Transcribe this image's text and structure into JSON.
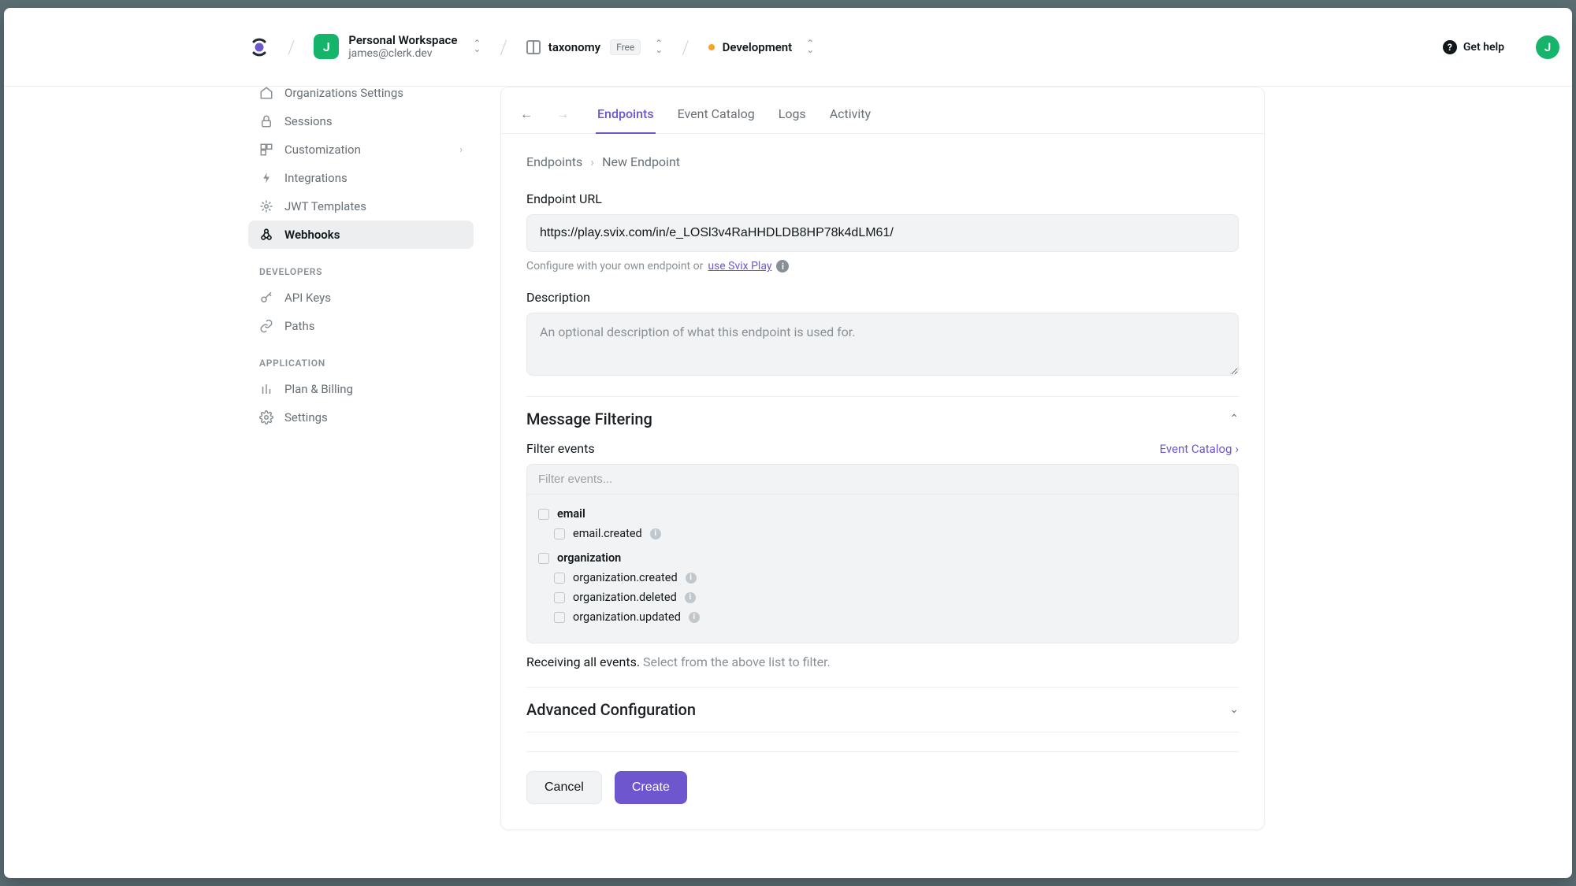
{
  "header": {
    "workspace": {
      "initial": "J",
      "name": "Personal Workspace",
      "email": "james@clerk.dev"
    },
    "app": {
      "name": "taxonomy",
      "plan": "Free"
    },
    "env": {
      "name": "Development"
    },
    "help_label": "Get help",
    "avatar_initial": "J"
  },
  "sidebar": {
    "main": [
      {
        "icon": "org",
        "label": "Organizations Settings"
      },
      {
        "icon": "lock",
        "label": "Sessions"
      },
      {
        "icon": "cust",
        "label": "Customization",
        "expandable": true
      },
      {
        "icon": "plug",
        "label": "Integrations"
      },
      {
        "icon": "jwt",
        "label": "JWT Templates"
      },
      {
        "icon": "hook",
        "label": "Webhooks",
        "active": true
      }
    ],
    "dev_head": "DEVELOPERS",
    "developers": [
      {
        "icon": "key",
        "label": "API Keys"
      },
      {
        "icon": "path",
        "label": "Paths"
      }
    ],
    "app_head": "APPLICATION",
    "application": [
      {
        "icon": "bill",
        "label": "Plan & Billing"
      },
      {
        "icon": "gear",
        "label": "Settings"
      }
    ]
  },
  "tabs": [
    "Endpoints",
    "Event Catalog",
    "Logs",
    "Activity"
  ],
  "active_tab": "Endpoints",
  "breadcrumb": {
    "root": "Endpoints",
    "leaf": "New Endpoint"
  },
  "form": {
    "url_label": "Endpoint URL",
    "url_value": "https://play.svix.com/in/e_LOSl3v4RaHHDLDB8HP78k4dLM61/",
    "url_hint_pre": "Configure with your own endpoint or ",
    "url_hint_link": "use Svix Play",
    "desc_label": "Description",
    "desc_placeholder": "An optional description of what this endpoint is used for.",
    "msg_filter_title": "Message Filtering",
    "filter_events_label": "Filter events",
    "event_catalog_link": "Event Catalog",
    "filter_placeholder": "Filter events...",
    "event_groups": [
      {
        "name": "email",
        "events": [
          "email.created"
        ]
      },
      {
        "name": "organization",
        "events": [
          "organization.created",
          "organization.deleted",
          "organization.updated"
        ]
      }
    ],
    "receiving_bold": "Receiving all events.",
    "receiving_rest": " Select from the above list to filter.",
    "adv_title": "Advanced Configuration",
    "cancel": "Cancel",
    "create": "Create"
  }
}
